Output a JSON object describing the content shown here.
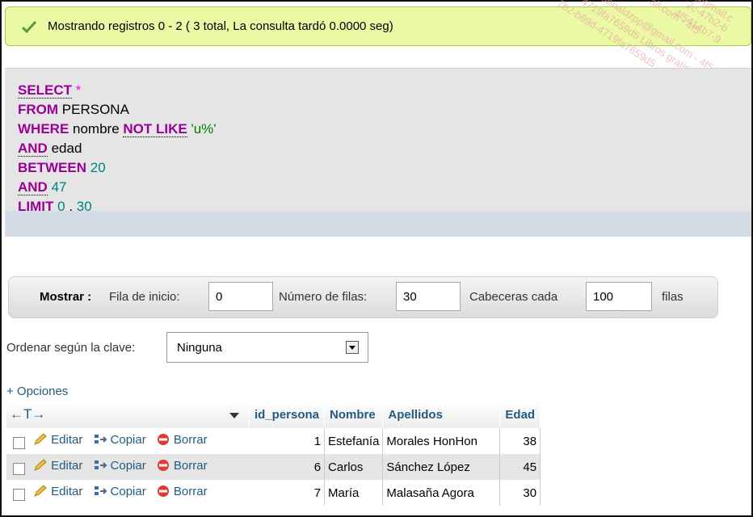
{
  "banner": {
    "message": "Mostrando registros 0 - 2 ( 3 total, La consulta tardó 0.0000 seg)"
  },
  "watermark": {
    "lines": [
      "@gmail.c",
      "2c-47b2-b",
      "4f5414b7-9",
      "ail.com - 4f5",
      "donaldzpp@gmail.com - 4f5414b7-9",
      "4719fa7659d5 Libros gratis",
      "7b2-b69d-4719fa7659d5"
    ]
  },
  "sql": {
    "select": "SELECT",
    "star": "*",
    "from": "FROM",
    "table": "PERSONA",
    "where": "WHERE",
    "col1": "nombre",
    "notlike": "NOT LIKE",
    "pattern": "'u%'",
    "and1": "AND",
    "col2": "edad",
    "between": "BETWEEN",
    "low": "20",
    "and2": "AND",
    "high": "47",
    "limit": "LIMIT",
    "offset": "0",
    "comma": ",",
    "count": "30"
  },
  "nav": {
    "mostrar": "Mostrar :",
    "fila_label": "Fila de inicio:",
    "fila_value": "0",
    "numero_label": "Número de filas:",
    "numero_value": "30",
    "cabeceras_label": "Cabeceras cada",
    "cabeceras_value": "100",
    "filas": "filas"
  },
  "sort": {
    "label": "Ordenar según la clave:",
    "selected": "Ninguna"
  },
  "options_link": "+ Opciones",
  "table": {
    "arrows": "←T→",
    "headers": [
      "id_persona",
      "Nombre",
      "Apellidos",
      "Edad"
    ],
    "actions": {
      "edit": "Editar",
      "copy": "Copiar",
      "delete": "Borrar"
    },
    "rows": [
      {
        "id": "1",
        "nombre": "Estefanía",
        "apellidos": "Morales HonHon",
        "edad": "38"
      },
      {
        "id": "6",
        "nombre": "Carlos",
        "apellidos": "Sánchez López",
        "edad": "45"
      },
      {
        "id": "7",
        "nombre": "María",
        "apellidos": "Malasaña Agora",
        "edad": "30"
      }
    ]
  },
  "colors": {
    "link": "#235a81",
    "keyword": "#990099",
    "success_bg": "#ebf8a4"
  }
}
